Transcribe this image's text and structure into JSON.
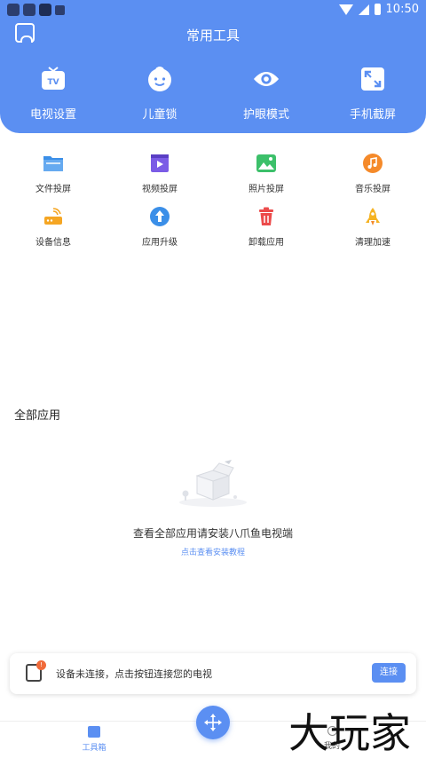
{
  "status_bar": {
    "time": "10:50"
  },
  "header": {
    "title": "常用工具"
  },
  "top_tools": [
    {
      "label": "电视设置",
      "icon": "tv-icon"
    },
    {
      "label": "儿童锁",
      "icon": "child-face-icon"
    },
    {
      "label": "护眼模式",
      "icon": "eye-icon"
    },
    {
      "label": "手机截屏",
      "icon": "screenshot-icon"
    }
  ],
  "tools": [
    {
      "label": "文件投屏",
      "icon": "folder-icon",
      "color": "#3b8fe8"
    },
    {
      "label": "视频投屏",
      "icon": "video-icon",
      "color": "#7b5ce6"
    },
    {
      "label": "照片投屏",
      "icon": "photo-icon",
      "color": "#3cc06a"
    },
    {
      "label": "音乐投屏",
      "icon": "music-icon",
      "color": "#f58a2a"
    },
    {
      "label": "设备信息",
      "icon": "router-icon",
      "color": "#f5a623"
    },
    {
      "label": "应用升级",
      "icon": "upgrade-icon",
      "color": "#3b8fe8"
    },
    {
      "label": "卸载应用",
      "icon": "trash-icon",
      "color": "#ec4b4b"
    },
    {
      "label": "清理加速",
      "icon": "rocket-icon",
      "color": "#f5b323"
    }
  ],
  "all_apps": {
    "title": "全部应用",
    "empty_text": "查看全部应用请安装八爪鱼电视端",
    "empty_link": "点击查看安装教程"
  },
  "banner": {
    "badge": "!",
    "text": "设备未连接，点击按钮连接您的电视",
    "button": "连接"
  },
  "bottom_nav": {
    "toolbox": "工具箱",
    "mine": "我的"
  },
  "watermark": "大玩家",
  "colors": {
    "primary": "#5b8ff2"
  }
}
